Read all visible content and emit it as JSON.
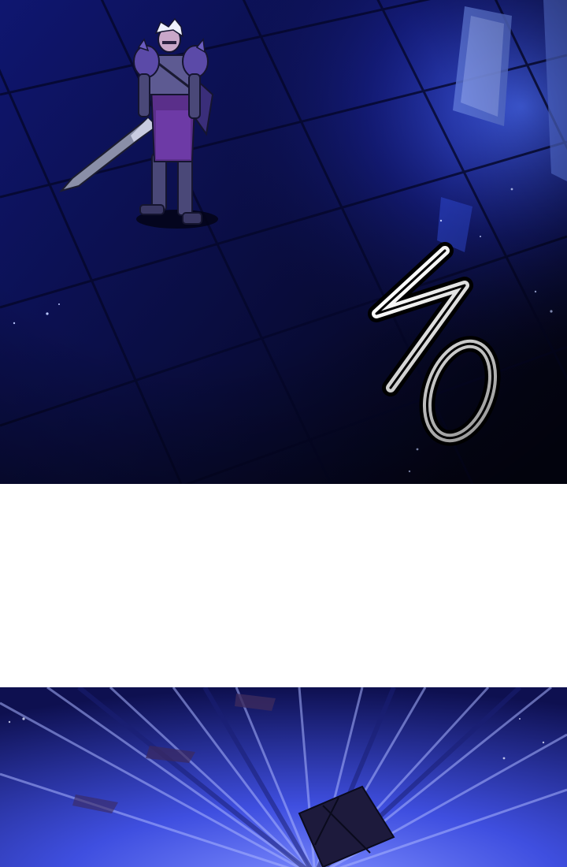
{
  "comic": {
    "sfx_text": "ノン",
    "colors": {
      "floor_dark": "#0a0d38",
      "floor_mid": "#1a24a0",
      "floor_light": "#3a5cff",
      "gutter": "#ffffff",
      "burst_light": "#6a7dff",
      "burst_dark": "#141a6a"
    }
  }
}
